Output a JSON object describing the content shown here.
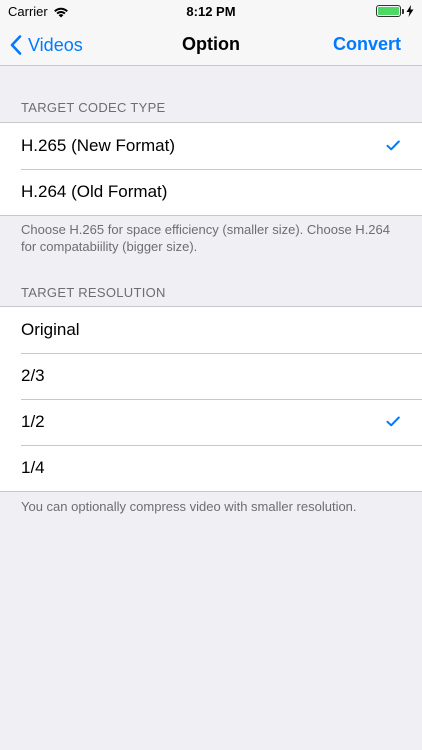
{
  "status_bar": {
    "carrier": "Carrier",
    "time": "8:12 PM"
  },
  "nav": {
    "back_label": "Videos",
    "title": "Option",
    "action_label": "Convert"
  },
  "codec_section": {
    "header": "TARGET CODEC TYPE",
    "options": [
      {
        "label": "H.265 (New Format)",
        "selected": true
      },
      {
        "label": "H.264 (Old Format)",
        "selected": false
      }
    ],
    "footer": "Choose H.265 for space efficiency (smaller size). Choose H.264 for compatabiility (bigger size)."
  },
  "resolution_section": {
    "header": "TARGET RESOLUTION",
    "options": [
      {
        "label": "Original",
        "selected": false
      },
      {
        "label": "2/3",
        "selected": false
      },
      {
        "label": "1/2",
        "selected": true
      },
      {
        "label": "1/4",
        "selected": false
      }
    ],
    "footer": "You can optionally compress video with smaller resolution."
  },
  "colors": {
    "accent": "#007aff",
    "background": "#efeff4",
    "battery": "#4cd964"
  }
}
